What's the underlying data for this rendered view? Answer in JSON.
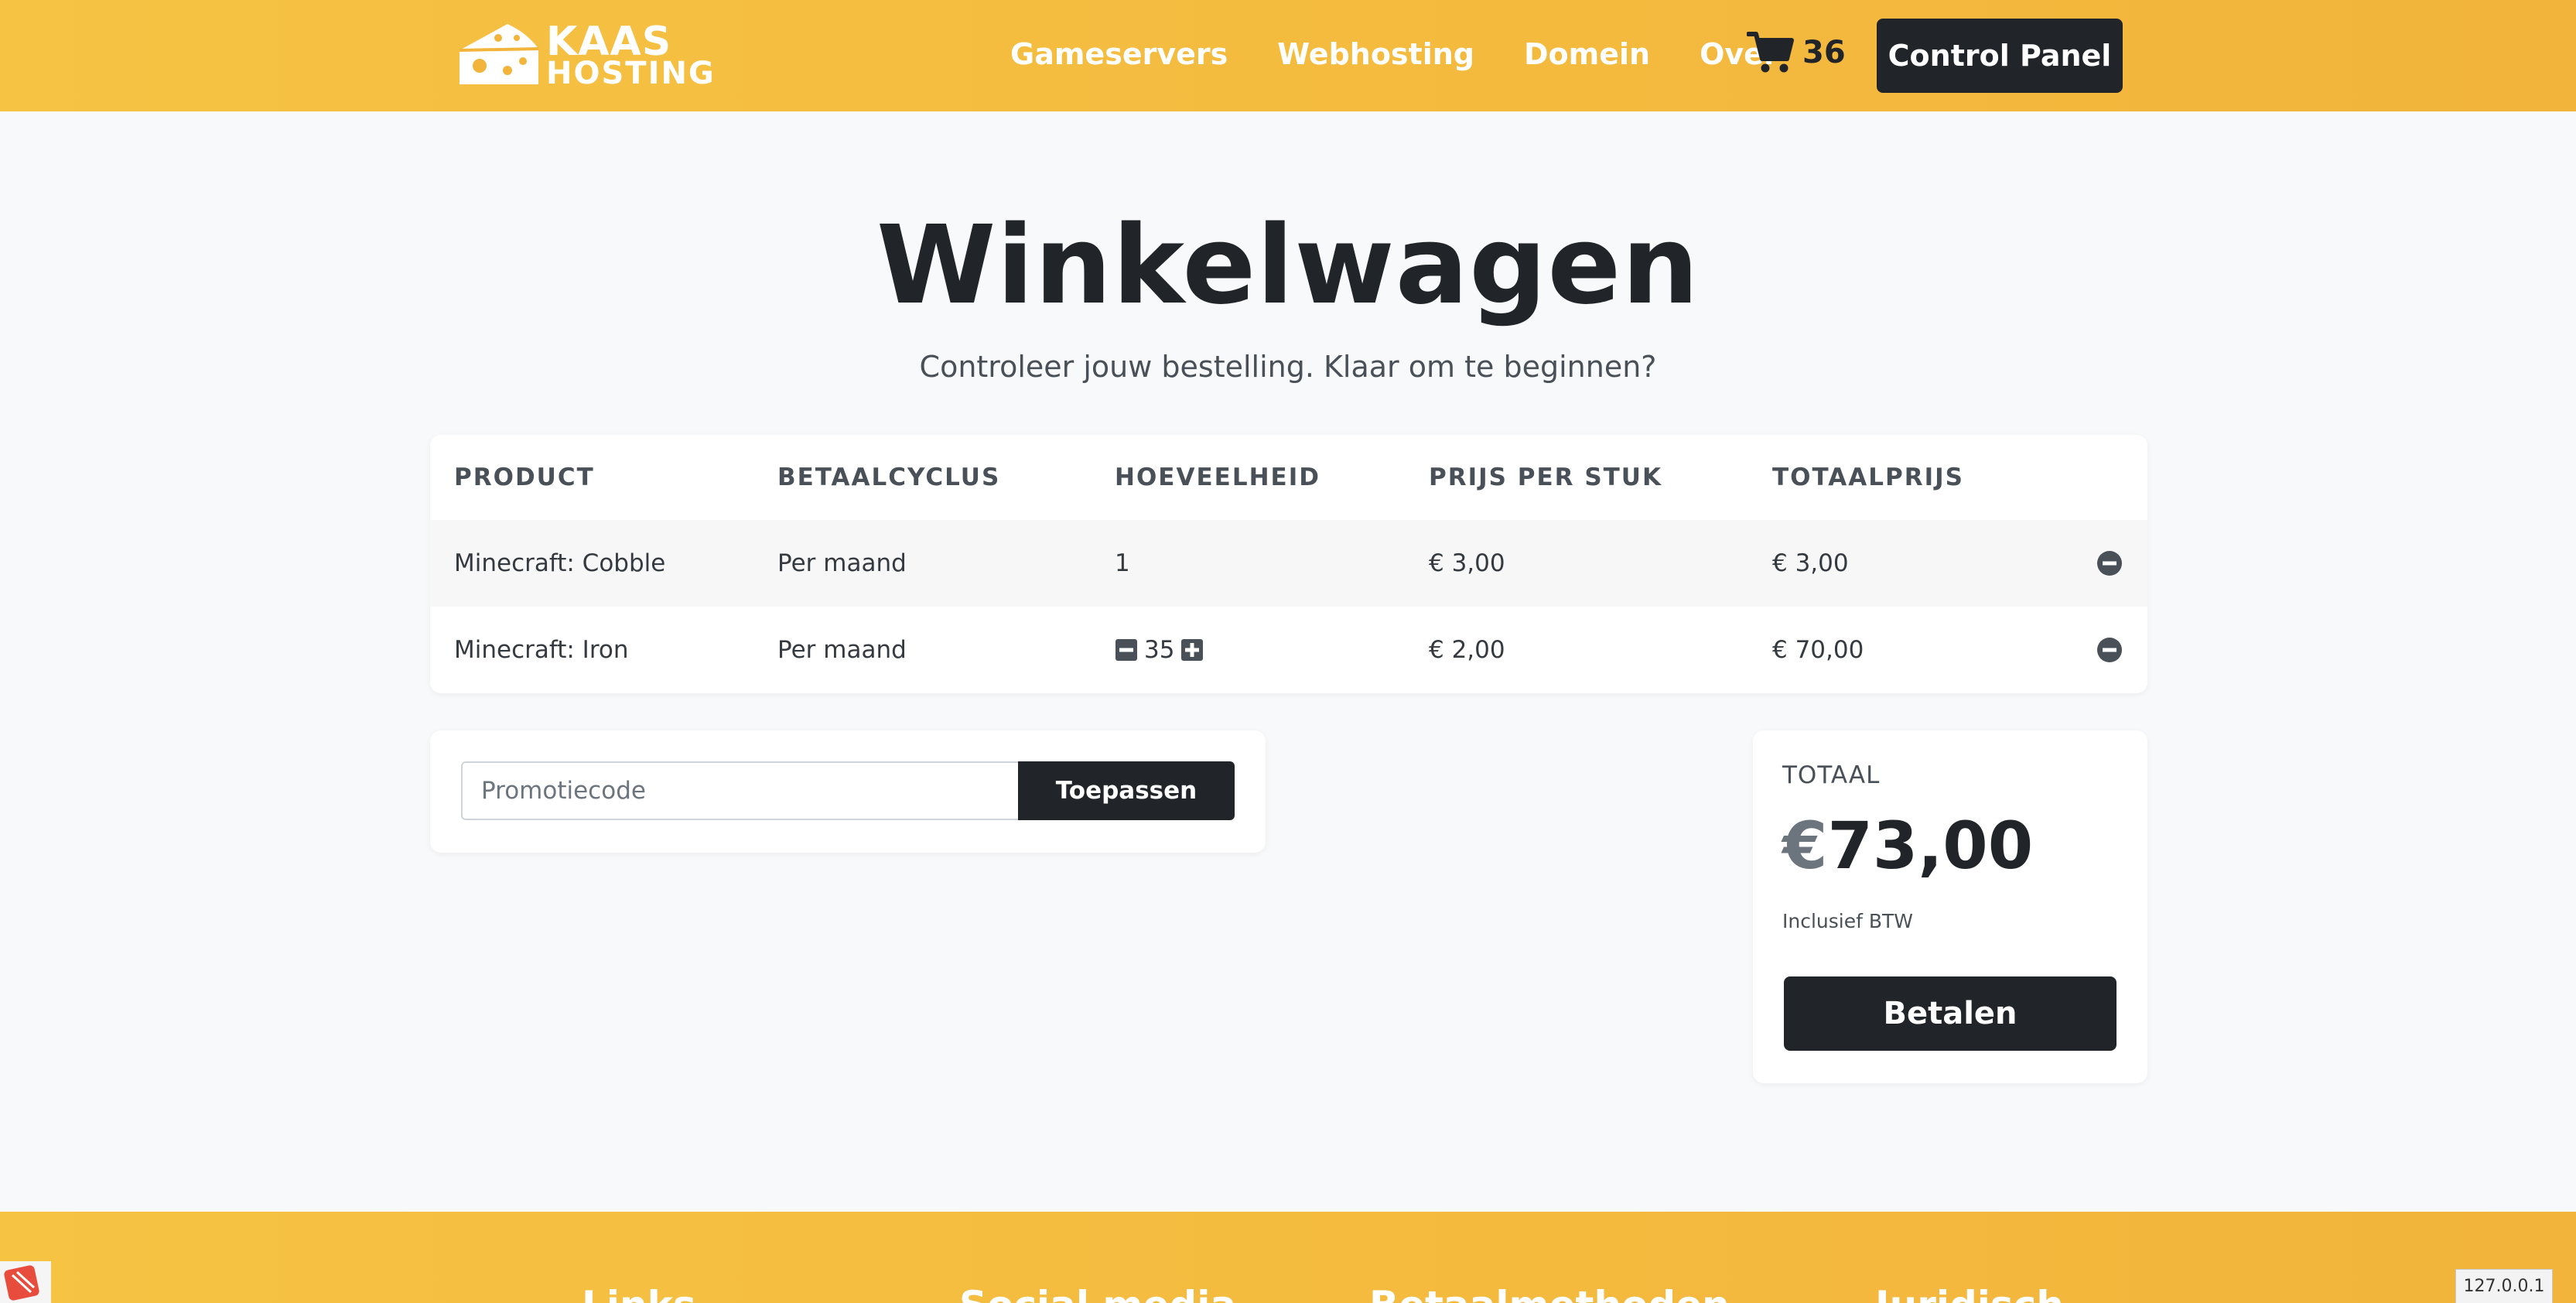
{
  "brand": {
    "logo_line1": "KAAS",
    "logo_line2": "HOSTING",
    "accent": "#f6c343",
    "dark": "#212529"
  },
  "nav": {
    "links": [
      "Gameservers",
      "Webhosting",
      "Domein",
      "Over"
    ],
    "cart_count": "36",
    "control_panel": "Control Panel"
  },
  "hero": {
    "title": "Winkelwagen",
    "subtitle": "Controleer jouw bestelling. Klaar om te beginnen?"
  },
  "cart": {
    "headers": [
      "PRODUCT",
      "BETAALCYCLUS",
      "HOEVEELHEID",
      "PRIJS PER STUK",
      "TOTAALPRIJS"
    ],
    "rows": [
      {
        "product": "Minecraft: Cobble",
        "cycle": "Per maand",
        "quantity": "1",
        "unit_price": "€ 3,00",
        "total": "€ 3,00"
      },
      {
        "product": "Minecraft: Iron",
        "cycle": "Per maand",
        "quantity": "35",
        "unit_price": "€ 2,00",
        "total": "€ 70,00"
      }
    ]
  },
  "promo": {
    "placeholder": "Promotiecode",
    "button": "Toepassen"
  },
  "summary": {
    "label": "TOTAAL",
    "currency": "€",
    "amount": "73,00",
    "note": "Inclusief BTW",
    "pay_button": "Betalen"
  },
  "footer": {
    "columns": [
      "Links",
      "Social media",
      "Betaalmethoden",
      "Juridisch"
    ]
  },
  "host_badge": "127.0.0.1"
}
